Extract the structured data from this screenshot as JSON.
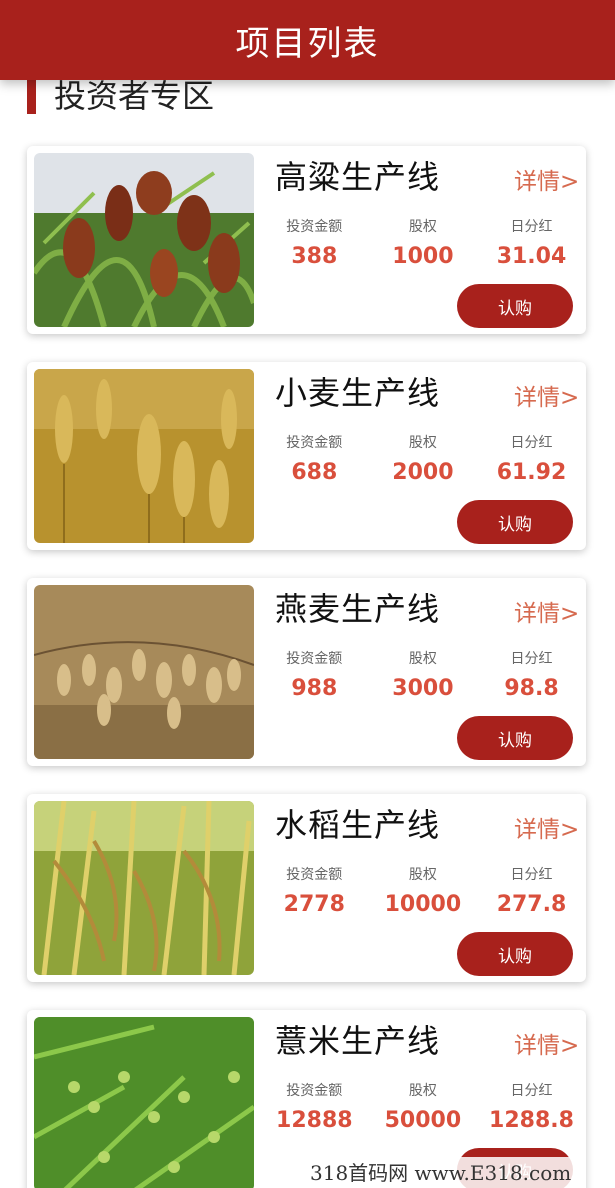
{
  "header": {
    "title": "项目列表"
  },
  "section": {
    "title": "投资者专区"
  },
  "labels": {
    "invest": "投资金额",
    "equity": "股权",
    "dividend": "日分红",
    "detail": "详情>",
    "buy": "认购"
  },
  "colors": {
    "brand": "#a8211c",
    "value": "#d94f3c",
    "detail": "#d66a4f"
  },
  "products": [
    {
      "name": "高粱生产线",
      "image": "sorghum",
      "invest": "388",
      "equity": "1000",
      "dividend": "31.04"
    },
    {
      "name": "小麦生产线",
      "image": "wheat",
      "invest": "688",
      "equity": "2000",
      "dividend": "61.92"
    },
    {
      "name": "燕麦生产线",
      "image": "oats",
      "invest": "988",
      "equity": "3000",
      "dividend": "98.8"
    },
    {
      "name": "水稻生产线",
      "image": "rice",
      "invest": "2778",
      "equity": "10000",
      "dividend": "277.8"
    },
    {
      "name": "薏米生产线",
      "image": "coix-seed",
      "invest": "12888",
      "equity": "50000",
      "dividend": "1288.8"
    }
  ],
  "watermark": "318首码网 www.E318.com"
}
